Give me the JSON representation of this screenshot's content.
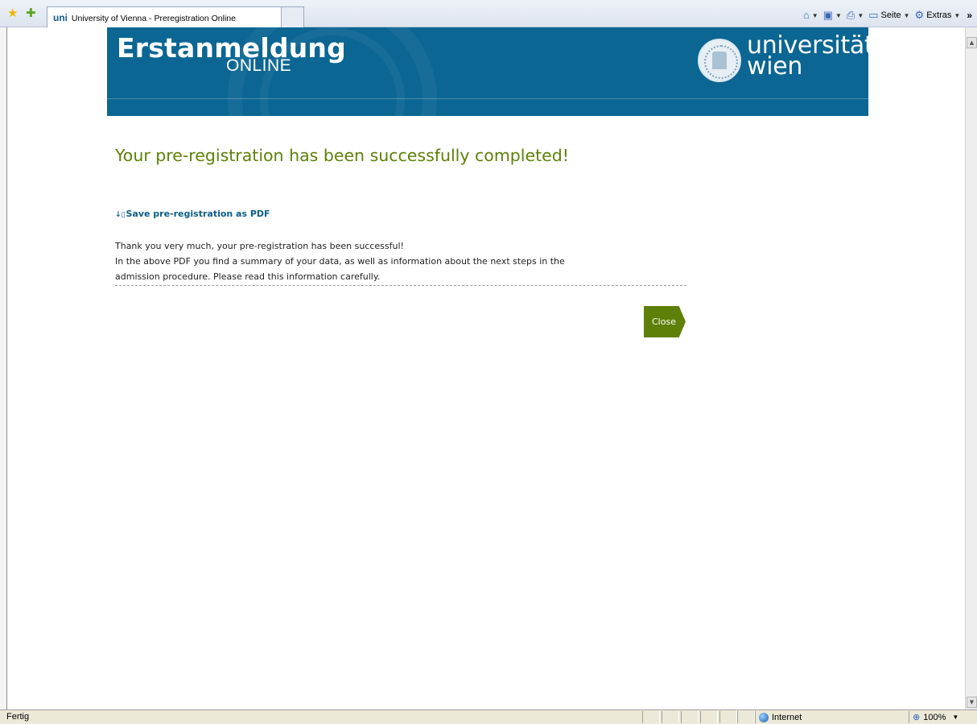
{
  "browser": {
    "tab_title": "University of Vienna - Preregistration Online",
    "tab_favicon": "uni",
    "commands": {
      "page_label": "Seite",
      "tools_label": "Extras",
      "overflow": "»"
    },
    "status": {
      "text": "Fertig",
      "zone": "Internet",
      "zoom": "100%"
    }
  },
  "banner": {
    "title": "Erstanmeldung",
    "subtitle": "ONLINE",
    "logo_line1": "universität",
    "logo_line2": "wien"
  },
  "main": {
    "success_title": "Your pre-registration has been successfully completed!",
    "pdf_link_icon": "↓▯",
    "pdf_link_label": "Save pre-registration as PDF",
    "message_lines": [
      "Thank you very much, your pre-registration has been successful!",
      "In the above PDF you find a summary of your data, as well as information about the next steps in the",
      "admission procedure. Please read this information carefully."
    ],
    "close_label": "Close"
  },
  "colors": {
    "banner_blue": "#0b6693",
    "accent_green": "#5f8008",
    "link_blue": "#0b5e89"
  }
}
